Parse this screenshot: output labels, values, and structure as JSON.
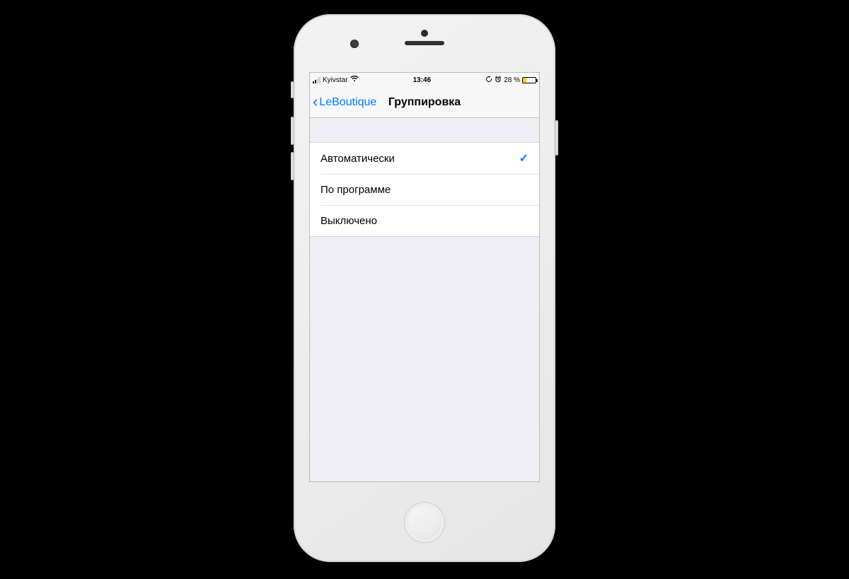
{
  "status": {
    "carrier": "Kyivstar",
    "time": "13:46",
    "battery_pct": "28 %"
  },
  "nav": {
    "back_label": "LeBoutique",
    "title": "Группировка"
  },
  "options": {
    "0": {
      "label": "Автоматически",
      "selected": true
    },
    "1": {
      "label": "По программе",
      "selected": false
    },
    "2": {
      "label": "Выключено",
      "selected": false
    }
  }
}
